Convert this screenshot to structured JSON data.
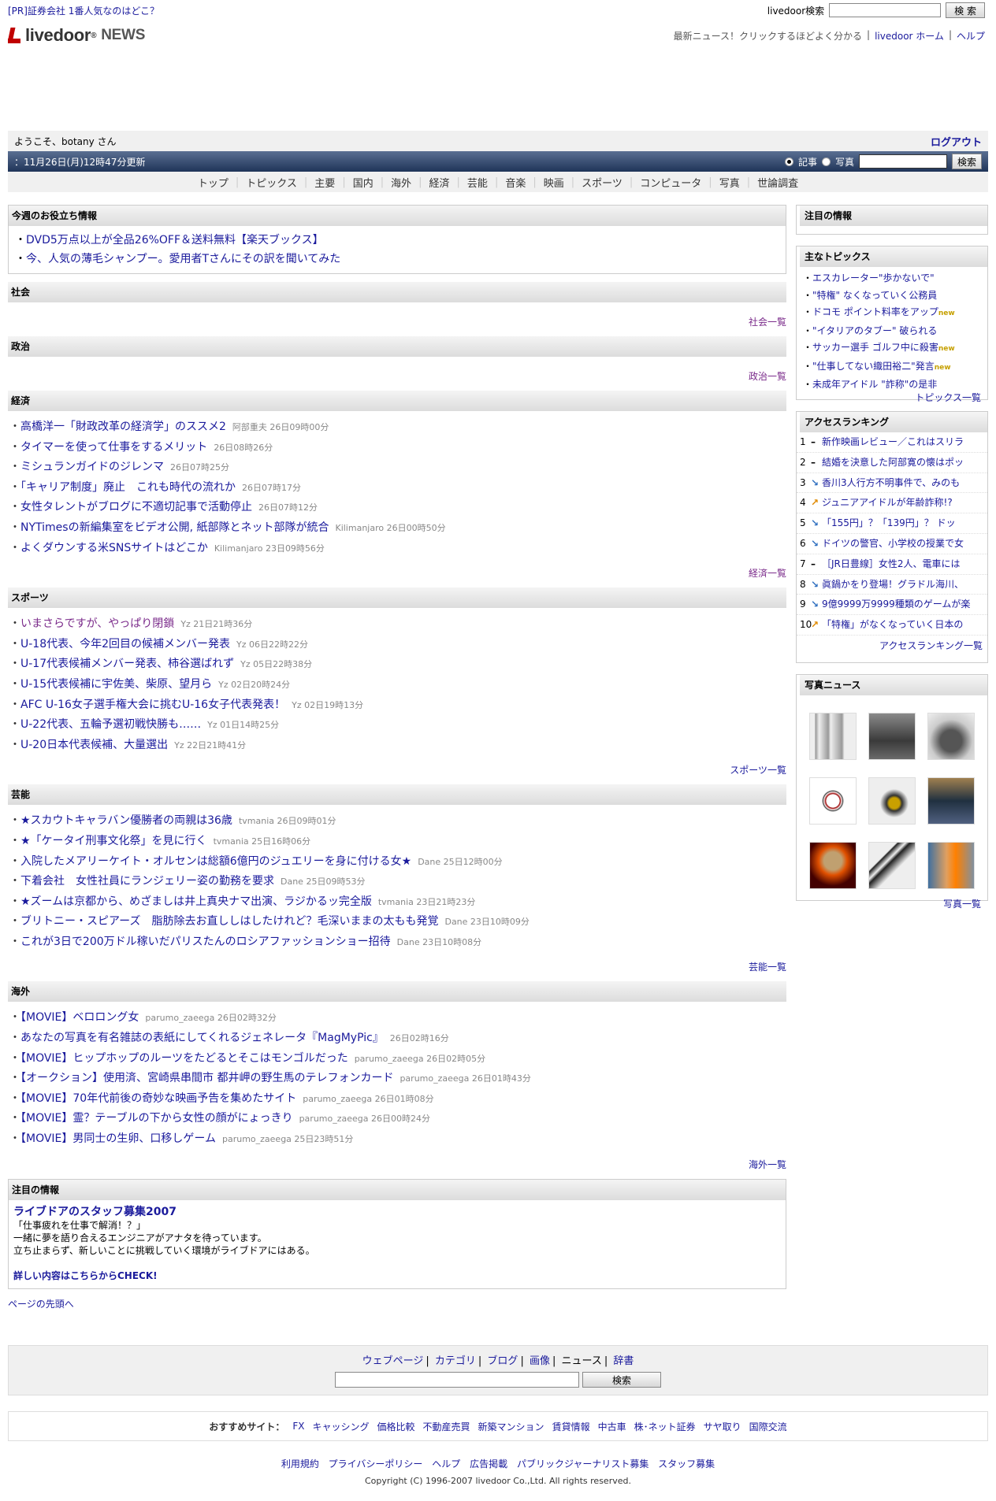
{
  "top": {
    "pr": "[PR]証券会社 1番人気なのはどこ？",
    "search_label": "livedoor検索",
    "search_value": "",
    "search_btn": "検 索"
  },
  "header": {
    "logo_text": "livedoor",
    "logo_news": "NEWS",
    "tagline": "最新ニュース！クリックするほどよく分かる",
    "home": "livedoor ホーム",
    "help": "ヘルプ",
    "sep": "|"
  },
  "welcome": {
    "text": "ようこそ、botany さん",
    "logout": "ログアウト"
  },
  "bar": {
    "updated": "：11月26日(月)12時47分更新",
    "opt_article": "記事",
    "opt_photo": "写真",
    "search_value": "",
    "search_btn": "検索"
  },
  "nav": [
    "トップ",
    "トピックス",
    "主要",
    "国内",
    "海外",
    "経済",
    "芸能",
    "音楽",
    "映画",
    "スポーツ",
    "コンピュータ",
    "写真",
    "世論調査"
  ],
  "useful": {
    "title": "今週のお役立ち情報",
    "items": [
      "DVD5万点以上が全品26%OFF＆送料無料【楽天ブックス】",
      "今、人気の薄毛シャンプー。愛用者Tさんにその訳を聞いてみた"
    ]
  },
  "sections": {
    "shakai": {
      "title": "社会",
      "more": "社会一覧"
    },
    "seiji": {
      "title": "政治",
      "more": "政治一覧"
    },
    "keizai": {
      "title": "経済",
      "more": "経済一覧",
      "items": [
        {
          "t": "高橋洋一「財政改革の経済学」のススメ2",
          "m": "阿部重夫 26日09時00分"
        },
        {
          "t": "タイマーを使って仕事をするメリット",
          "m": "26日08時26分"
        },
        {
          "t": "ミシュランガイドのジレンマ",
          "m": "26日07時25分"
        },
        {
          "t": "「キャリア制度」廃止　これも時代の流れか",
          "m": "26日07時17分"
        },
        {
          "t": "女性タレントがブログに不適切記事で活動停止",
          "m": "26日07時12分"
        },
        {
          "t": "NYTimesの新編集室をビデオ公開, 紙部隊とネット部隊が統合",
          "m": "Kilimanjaro 26日00時50分"
        },
        {
          "t": "よくダウンする米SNSサイトはどこか",
          "m": "Kilimanjaro 23日09時56分"
        }
      ]
    },
    "sports": {
      "title": "スポーツ",
      "more": "スポーツ一覧",
      "items": [
        {
          "t": "いまさらですが、やっぱり閉鎖",
          "m": "Yz 21日21時36分"
        },
        {
          "t": "U-18代表、今年2回目の候補メンバー発表",
          "m": "Yz 06日22時22分"
        },
        {
          "t": "U-17代表候補メンバー発表、柿谷選ばれず",
          "m": "Yz 05日22時38分"
        },
        {
          "t": "U-15代表候補に宇佐美、柴原、望月ら",
          "m": "Yz 02日20時24分"
        },
        {
          "t": "AFC U-16女子選手権大会に挑むU-16女子代表発表！",
          "m": "Yz 02日19時13分"
        },
        {
          "t": "U-22代表、五輪予選初戦快勝も……",
          "m": "Yz 01日14時25分"
        },
        {
          "t": "U-20日本代表候補、大量選出",
          "m": "Yz 22日21時41分"
        }
      ]
    },
    "geino": {
      "title": "芸能",
      "more": "芸能一覧",
      "items": [
        {
          "t": "★スカウトキャラバン優勝者の両親は36歳",
          "m": "tvmania 26日09時01分"
        },
        {
          "t": "★「ケータイ刑事文化祭」を見に行く",
          "m": "tvmania 25日16時06分"
        },
        {
          "t": "入院したメアリーケイト・オルセンは総額6億円のジュエリーを身に付ける女★",
          "m": "Dane 25日12時00分"
        },
        {
          "t": "下着会社　女性社員にランジェリー姿の勤務を要求",
          "m": "Dane 25日09時53分"
        },
        {
          "t": "★ズームは京都から、めざましは井上真央ナマ出演、ラジかるッ完全版",
          "m": "tvmania 23日21時23分"
        },
        {
          "t": "ブリトニー・スピアーズ　脂肪除去お直ししはしたけれど？毛深いままの太もも発覚",
          "m": "Dane 23日10時09分"
        },
        {
          "t": "これが3日で200万ドル稼いだパリスたんのロシアファッションショー招待",
          "m": "Dane 23日10時08分"
        }
      ]
    },
    "kaigai": {
      "title": "海外",
      "more": "海外一覧",
      "items": [
        {
          "t": "【MOVIE】ベロロング女",
          "m": "parumo_zaeega 26日02時32分"
        },
        {
          "t": "あなたの写真を有名雑誌の表紙にしてくれるジェネレータ『MagMyPic』",
          "m": "26日02時16分"
        },
        {
          "t": "【MOVIE】ヒップホップのルーツをたどるとそこはモンゴルだった",
          "m": "parumo_zaeega 26日02時05分"
        },
        {
          "t": "【オークション】使用済、宮崎県串間市 都井岬の野生馬のテレフォンカード",
          "m": "parumo_zaeega 26日01時43分"
        },
        {
          "t": "【MOVIE】70年代前後の奇妙な映画予告を集めたサイト",
          "m": "parumo_zaeega 26日01時08分"
        },
        {
          "t": "【MOVIE】霊？テーブルの下から女性の顔がにょっきり",
          "m": "parumo_zaeega 26日00時24分"
        },
        {
          "t": "【MOVIE】男同士の生卵、口移しゲーム",
          "m": "parumo_zaeega 25日23時51分"
        }
      ]
    }
  },
  "attention": {
    "title": "注目の情報",
    "headline": "ライブドアのスタッフ募集2007",
    "l1": "「仕事疲れを仕事で解消！？」",
    "l2": "一緒に夢を語り合えるエンジニアがアナタを待っています。",
    "l3": "立ち止まらず、新しいことに挑戦していく環境がライブドアにはある。",
    "check": "詳しい内容はこちらからCHECK!"
  },
  "pagetop": "ページの先頭へ",
  "side": {
    "attn_title": "注目の情報",
    "topics": {
      "title": "主なトピックス",
      "new": "new",
      "more": "トピックス一覧",
      "items": [
        {
          "t": "エスカレーター\"歩かないで\"",
          "n": false
        },
        {
          "t": "\"特権\" なくなっていく公務員",
          "n": false
        },
        {
          "t": "ドコモ ポイント料率をアップ",
          "n": true
        },
        {
          "t": "\"イタリアのタブー\" 破られる",
          "n": false
        },
        {
          "t": "サッカー選手 ゴルフ中に殺害",
          "n": true
        },
        {
          "t": "\"仕事してない織田裕二\"発言",
          "n": true
        },
        {
          "t": "未成年アイドル \"詐称\"の是非",
          "n": false
        }
      ]
    },
    "ranking": {
      "title": "アクセスランキング",
      "more": "アクセスランキング一覧",
      "items": [
        {
          "n": "1",
          "a": "–",
          "d": "s",
          "t": "新作映画レビュー／これはスリラ"
        },
        {
          "n": "2",
          "a": "–",
          "d": "s",
          "t": "結婚を決意した阿部寛の懐はポッ"
        },
        {
          "n": "3",
          "a": "↘",
          "d": "d",
          "t": "香川3人行方不明事件で、みのも"
        },
        {
          "n": "4",
          "a": "↗",
          "d": "u",
          "t": "ジュニアアイドルが年齢詐称!?"
        },
        {
          "n": "5",
          "a": "↘",
          "d": "d",
          "t": "「155円」？「139円」？ ドッ"
        },
        {
          "n": "6",
          "a": "↘",
          "d": "d",
          "t": "ドイツの警官、小学校の授業で女"
        },
        {
          "n": "7",
          "a": "–",
          "d": "s",
          "t": "［JR日豊線］女性2人、電車には"
        },
        {
          "n": "8",
          "a": "↘",
          "d": "d",
          "t": "眞鍋かをり登場！グラドル海川、"
        },
        {
          "n": "9",
          "a": "↘",
          "d": "d",
          "t": "9億9999万9999種類のゲームが楽"
        },
        {
          "n": "10",
          "a": "↗",
          "d": "u",
          "t": "「特権」がなくなっていく日本の"
        }
      ]
    },
    "photos": {
      "title": "写真ニュース",
      "more": "写真一覧"
    }
  },
  "footer": {
    "tabs": [
      "ウェブページ",
      "カテゴリ",
      "ブログ",
      "画像",
      "ニュース",
      "辞書"
    ],
    "search_value": "",
    "search_btn": "検索",
    "rec_label": "おすすめサイト：",
    "rec": [
      "FX",
      "キャッシング",
      "価格比較",
      "不動産売買",
      "新築マンション",
      "賃貸情報",
      "中古車",
      "株･ネット証券",
      "サヤ取り",
      "国際交流"
    ],
    "links": [
      "利用規約",
      "プライバシーポリシー",
      "ヘルプ",
      "広告掲載",
      "パブリックジャーナリスト募集",
      "スタッフ募集"
    ],
    "copyright": "Copyright (C) 1996-2007 livedoor Co.,Ltd. All rights reserved."
  }
}
